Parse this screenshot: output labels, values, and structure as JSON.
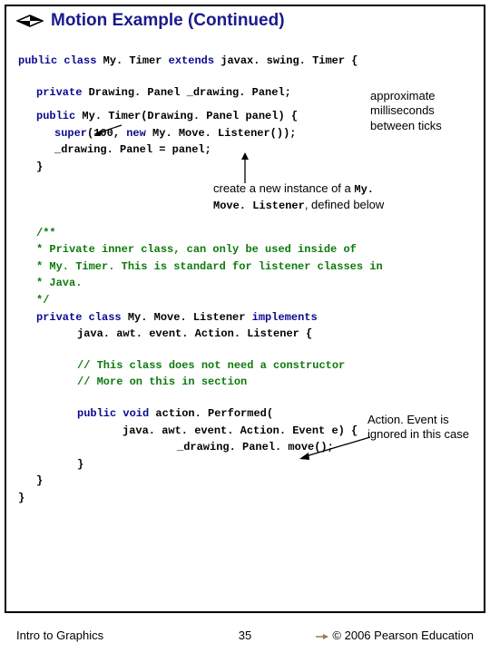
{
  "header": {
    "title": "Motion Example (Continued)"
  },
  "code": {
    "l1a": "public class ",
    "l1b": "My. Timer ",
    "l1c": "extends ",
    "l1d": "javax. swing. Timer {",
    "l2a": "private ",
    "l2b": "Drawing. Panel _drawing. Panel;",
    "l3a": "public ",
    "l3b": "My. Timer(Drawing. Panel panel) {",
    "l4a": "super",
    "l4b": "(100, ",
    "l4c": "new ",
    "l4d": "My. Move. Listener());",
    "l5": "_drawing. Panel = panel;",
    "l6": "}",
    "c1": "/**",
    "c2": "* Private inner class, can only be used inside of",
    "c3": "* My. Timer. This is standard for listener classes in",
    "c4": "* Java.",
    "c5": "*/",
    "l7a": "private class ",
    "l7b": "My. Move. Listener ",
    "l7c": "implements",
    "l8": "java. awt. event. Action. Listener {",
    "c6": "// This class does not need a constructor",
    "c7": "// More on this in section",
    "l9a": "public void ",
    "l9b": "action. Performed(",
    "l10": "java. awt. event. Action. Event e) {",
    "l11": "_drawing. Panel. move();",
    "l12": "}",
    "l13": "}",
    "l14": "}"
  },
  "annotations": {
    "a1": "approximate milliseconds between ticks",
    "a2a": "create a new instance of a ",
    "a2b": "My. Move. Listener",
    "a2c": ", defined below",
    "a3": "Action. Event is ignored in this case"
  },
  "footer": {
    "left": "Intro to Graphics",
    "page": "35",
    "right": "© 2006 Pearson Education"
  }
}
